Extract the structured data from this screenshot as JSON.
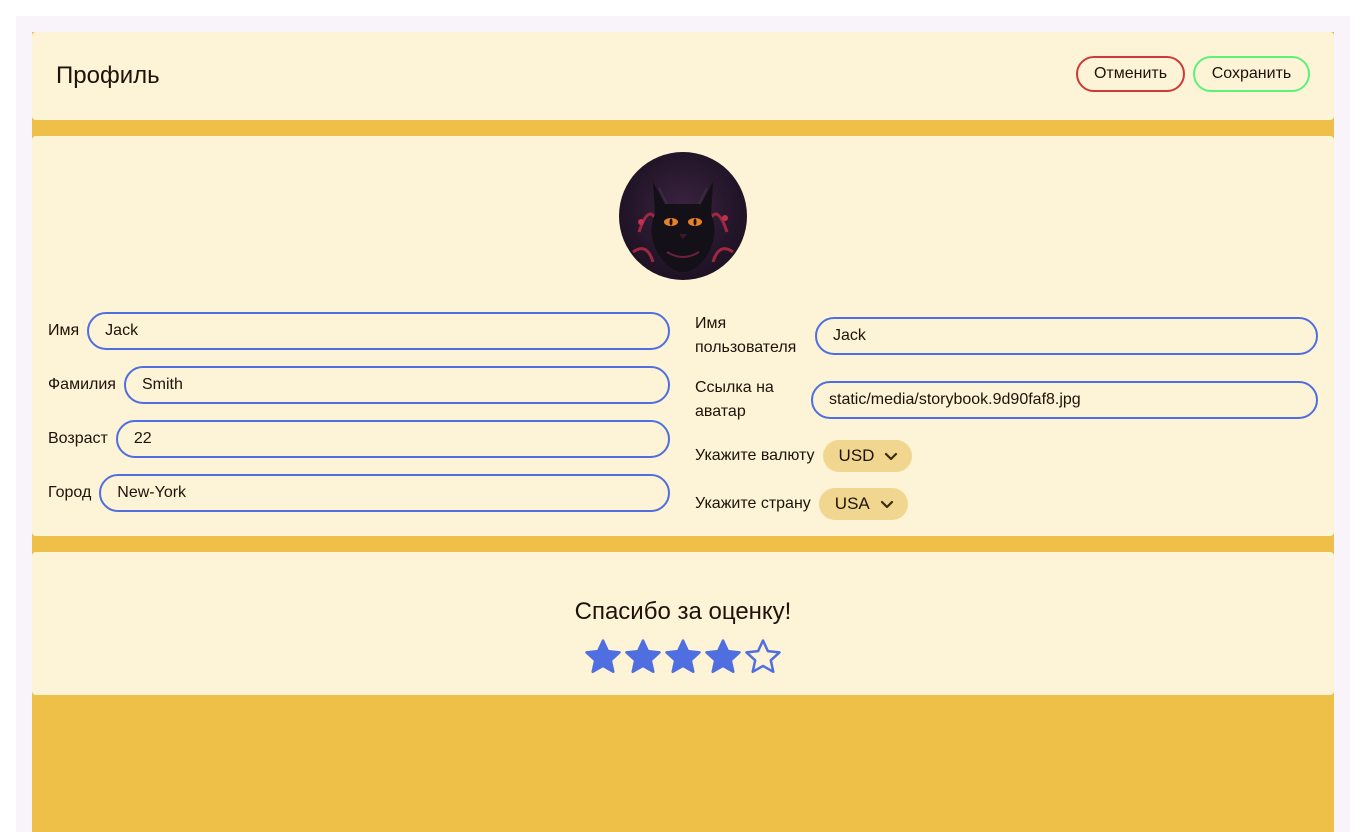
{
  "header": {
    "title": "Профиль",
    "cancel_label": "Отменить",
    "save_label": "Сохранить"
  },
  "form": {
    "first_name": {
      "label": "Имя",
      "value": "Jack"
    },
    "last_name": {
      "label": "Фамилия",
      "value": "Smith"
    },
    "age": {
      "label": "Возраст",
      "value": "22"
    },
    "city": {
      "label": "Город",
      "value": "New-York"
    },
    "username": {
      "label": "Имя пользователя",
      "value": "Jack"
    },
    "avatar_link": {
      "label": "Ссылка на аватар",
      "value": "static/media/storybook.9d90faf8.jpg"
    },
    "currency": {
      "label": "Укажите валюту",
      "value": "USD"
    },
    "country": {
      "label": "Укажите страну",
      "value": "USA"
    }
  },
  "rating": {
    "title": "Спасибо за оценку!",
    "score": 4,
    "max": 5
  },
  "colors": {
    "accent": "#4f6fe0",
    "cancel": "#cc3b3b",
    "save": "#5cf27a",
    "card": "#fdf3d6",
    "stage": "#efc048",
    "select": "#f0d68f"
  },
  "icons": {
    "avatar": "black-cat-avatar",
    "select_arrow": "chevron-down-icon",
    "rating": "star-icon"
  }
}
